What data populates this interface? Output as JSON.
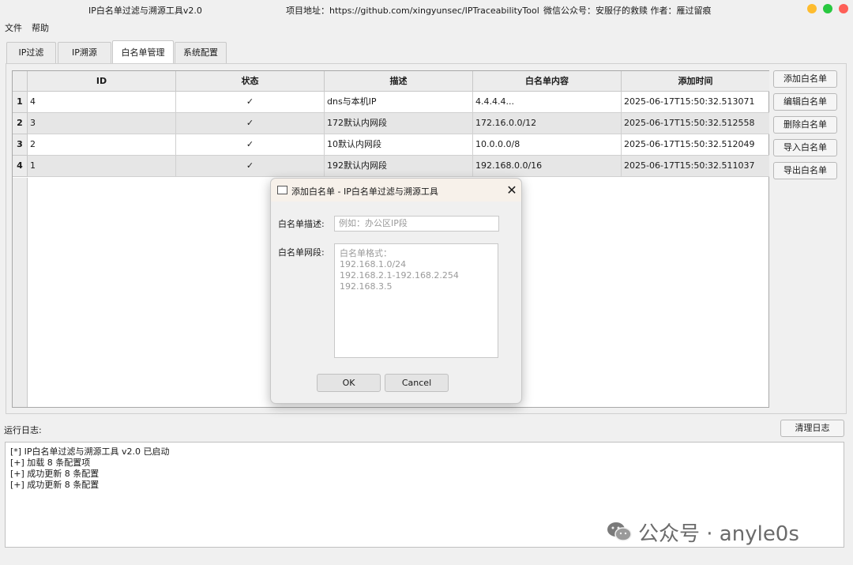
{
  "window": {
    "app_title": "IP白名单过滤与溯源工具v2.0",
    "project_url": "项目地址：https://github.com/xingyunsec/IPTraceabilityTool",
    "wechat_author": "微信公众号：安服仔的救赎   作者：雁过留痕",
    "controls": [
      "close-dot",
      "minimize-dot",
      "maximize-dot"
    ],
    "colors": {
      "close": "#fe5f57",
      "minimize": "#febc2e",
      "maximize": "#28c840"
    }
  },
  "menu": {
    "file": "文件",
    "help": "帮助"
  },
  "tabs": [
    {
      "label": "IP过滤"
    },
    {
      "label": "IP溯源"
    },
    {
      "label": "白名单管理",
      "active": true
    },
    {
      "label": "系统配置"
    }
  ],
  "table": {
    "headers": [
      "ID",
      "状态",
      "描述",
      "白名单内容",
      "添加时间"
    ],
    "rows": [
      {
        "num": "1",
        "id": "4",
        "status": "✓",
        "desc": "dns与本机IP",
        "content": "4.4.4.4...",
        "time": "2025-06-17T15:50:32.513071"
      },
      {
        "num": "2",
        "id": "3",
        "status": "✓",
        "desc": "172默认内网段",
        "content": "172.16.0.0/12",
        "time": "2025-06-17T15:50:32.512558"
      },
      {
        "num": "3",
        "id": "2",
        "status": "✓",
        "desc": "10默认内网段",
        "content": "10.0.0.0/8",
        "time": "2025-06-17T15:50:32.512049"
      },
      {
        "num": "4",
        "id": "1",
        "status": "✓",
        "desc": "192默认内网段",
        "content": "192.168.0.0/16",
        "time": "2025-06-17T15:50:32.511037"
      }
    ]
  },
  "side_buttons": {
    "add": "添加白名单",
    "edit": "编辑白名单",
    "delete": "删除白名单",
    "import": "导入白名单",
    "export": "导出白名单"
  },
  "log": {
    "label": "运行日志:",
    "clear": "清理日志",
    "lines": [
      "[*] IP白名单过滤与溯源工具 v2.0 已启动",
      "[+] 加载 8 条配置项",
      "[+] 成功更新 8 条配置",
      "[+] 成功更新 8 条配置"
    ]
  },
  "watermark": {
    "text": "公众号 · anyle0s",
    "icon": "wechat-icon"
  },
  "dialog": {
    "title": "添加白名单 - IP白名单过滤与溯源工具",
    "desc_label": "白名单描述:",
    "desc_placeholder": "例如：办公区IP段",
    "range_label": "白名单网段:",
    "range_placeholder_lines": [
      "白名单格式：",
      "192.168.1.0/24",
      "192.168.2.1-192.168.2.254",
      "192.168.3.5"
    ],
    "ok": "OK",
    "cancel": "Cancel"
  }
}
